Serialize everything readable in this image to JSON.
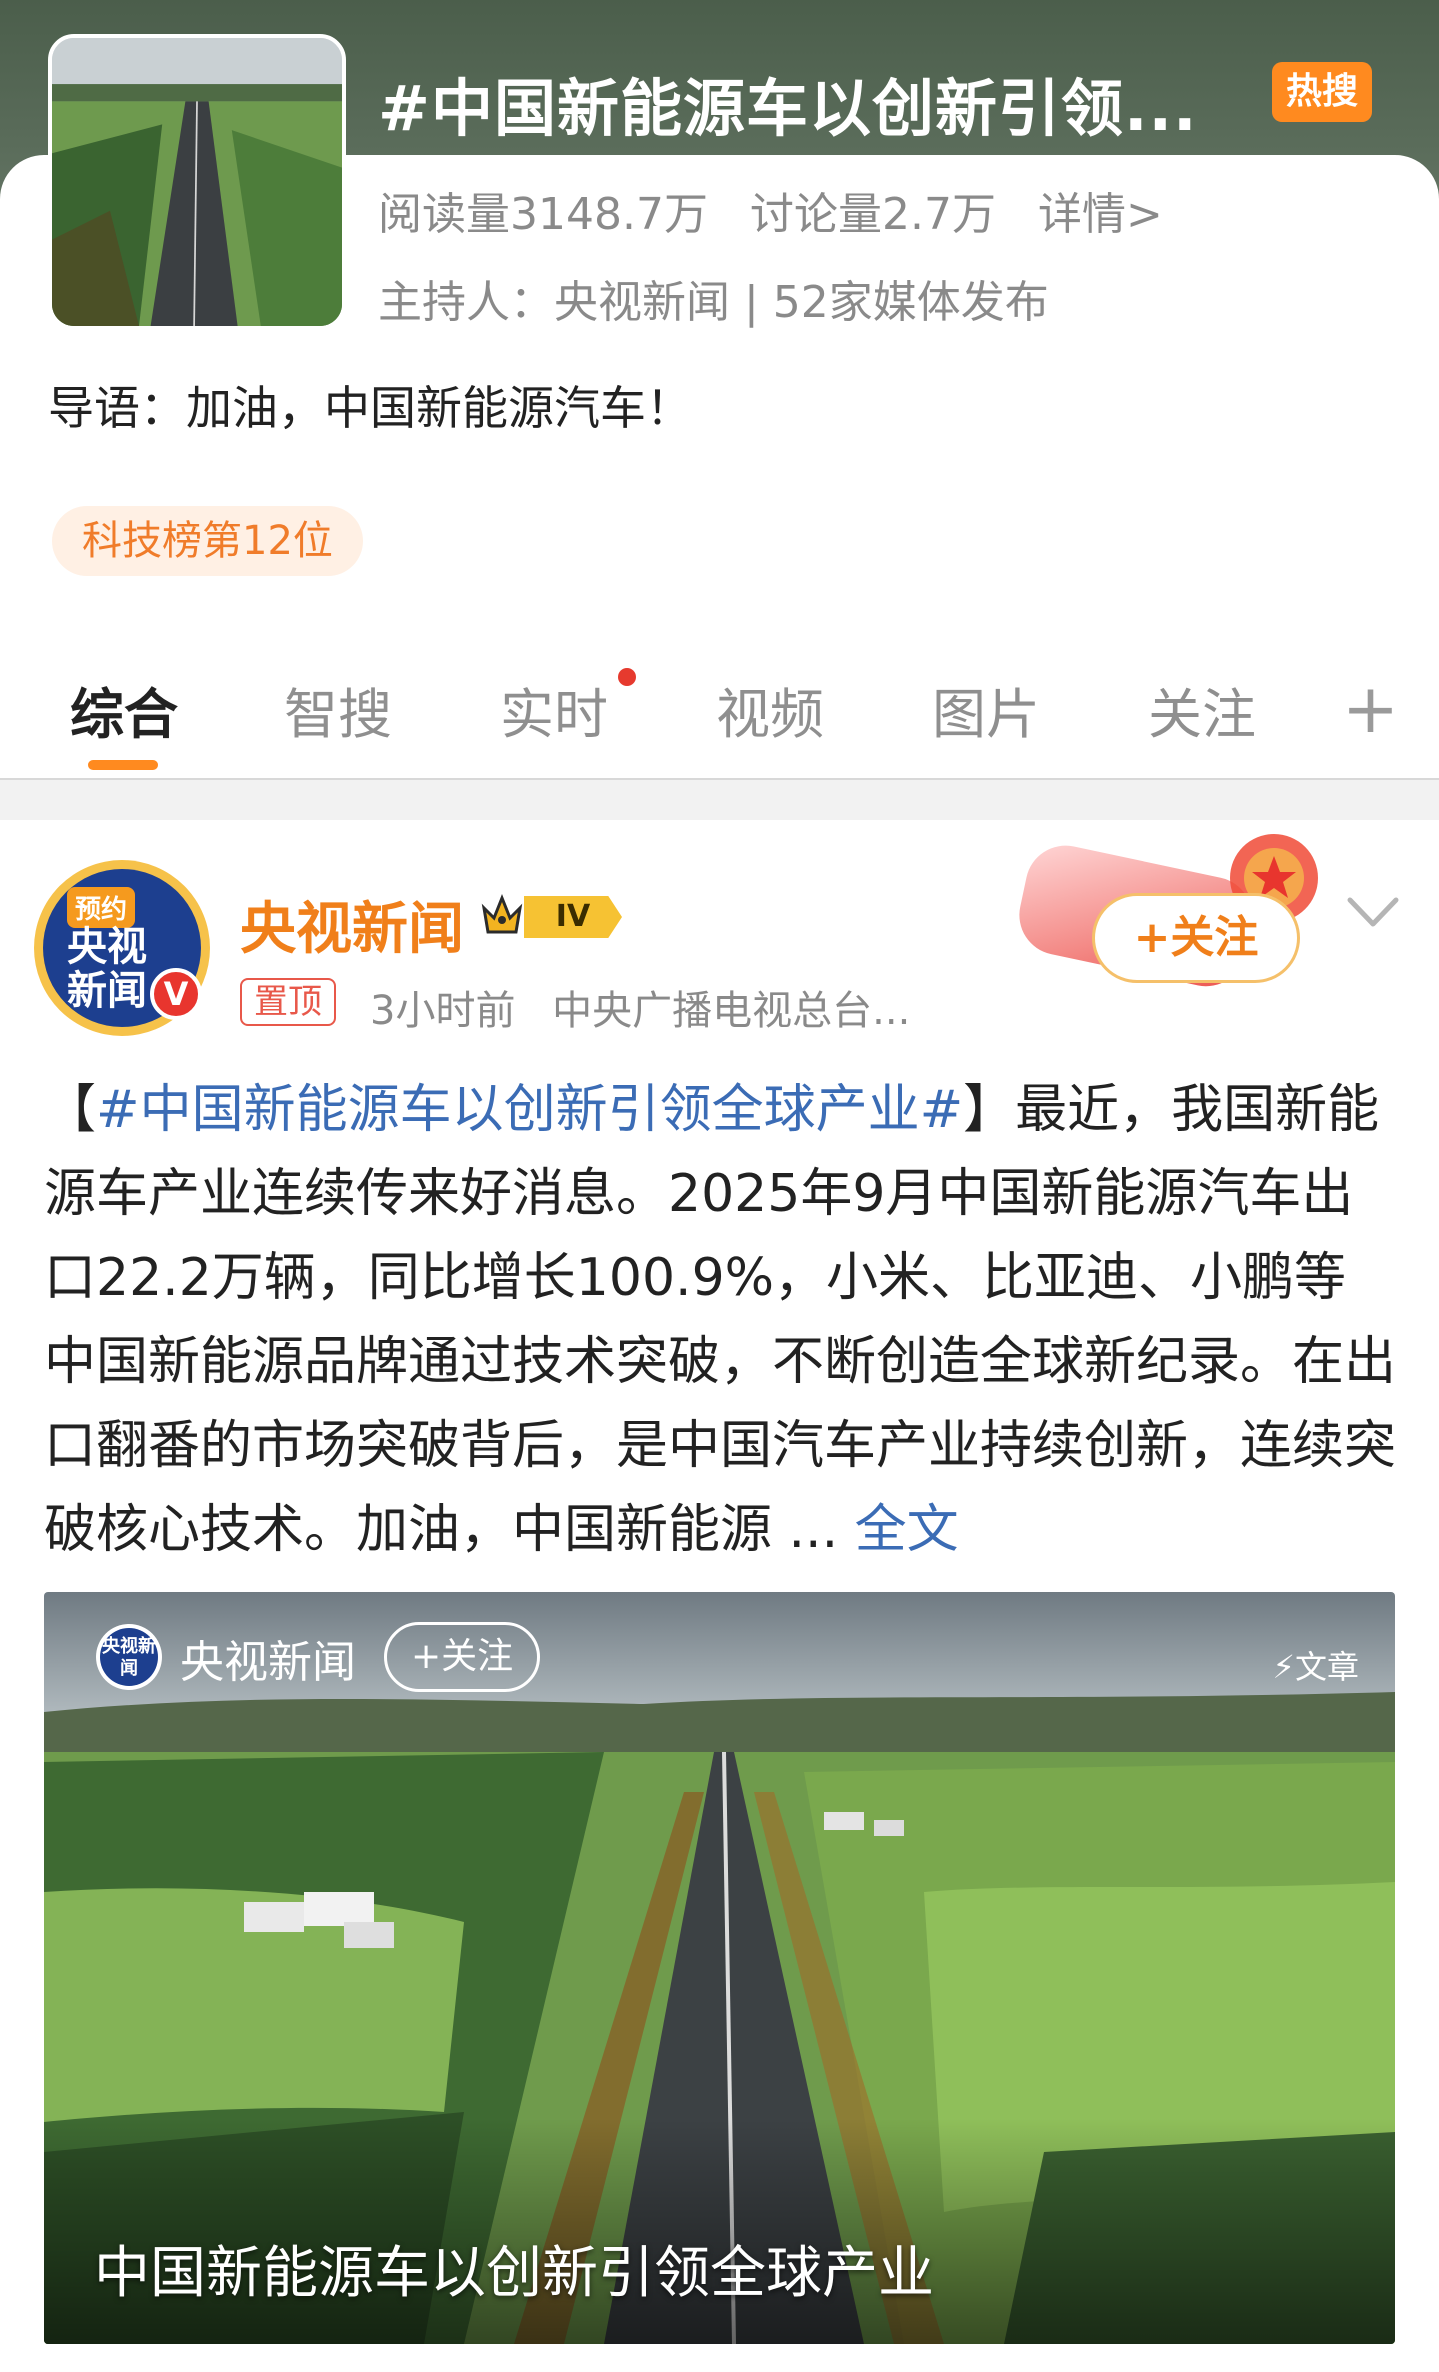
{
  "topic": {
    "title": "#中国新能源车以创新引领...",
    "hot_badge": "热搜",
    "reads": "阅读量3148.7万",
    "discussions": "讨论量2.7万",
    "details_link": "详情>",
    "host_line": "主持人：央视新闻 | 52家媒体发布",
    "guide": "导语：加油，中国新能源汽车！",
    "rank": "科技榜第12位"
  },
  "tabs": [
    {
      "label": "综合",
      "active": true
    },
    {
      "label": "智搜",
      "active": false
    },
    {
      "label": "实时",
      "active": false,
      "dot": true
    },
    {
      "label": "视频",
      "active": false
    },
    {
      "label": "图片",
      "active": false
    },
    {
      "label": "关注",
      "active": false
    }
  ],
  "tabs_plus": "+",
  "post": {
    "avatar_tag": "预约",
    "avatar_text": "央视新闻",
    "verified_mark": "V",
    "author": "央视新闻",
    "level": "IV",
    "pinned": "置顶",
    "time": "3小时前",
    "source": "中央广播电视总台...",
    "follow_label": "+关注",
    "body_prefix": "【",
    "hashtag": "#中国新能源车以创新引领全球产业#",
    "body_text": "】最近，我国新能源车产业连续传来好消息。2025年9月中国新能源汽车出口22.2万辆，同比增长100.9%，小米、比亚迪、小鹏等中国新能源品牌通过技术突破，不断创造全球新纪录。在出口翻番的市场突破背后，是中国汽车产业持续创新，连续突破核心技术。加油，中国新能源 ... ",
    "more_link": "全文"
  },
  "image_card": {
    "logo_text": "央视新闻",
    "source": "央视新闻",
    "follow_label": "+关注",
    "type_label": "⚡文章",
    "caption": "中国新能源车以创新引领全球产业"
  },
  "colors": {
    "accent_orange": "#ff8a1f",
    "link_blue": "#3b6cb5",
    "author_orange": "#f07f1a",
    "header_green": "#4b5e4b"
  }
}
